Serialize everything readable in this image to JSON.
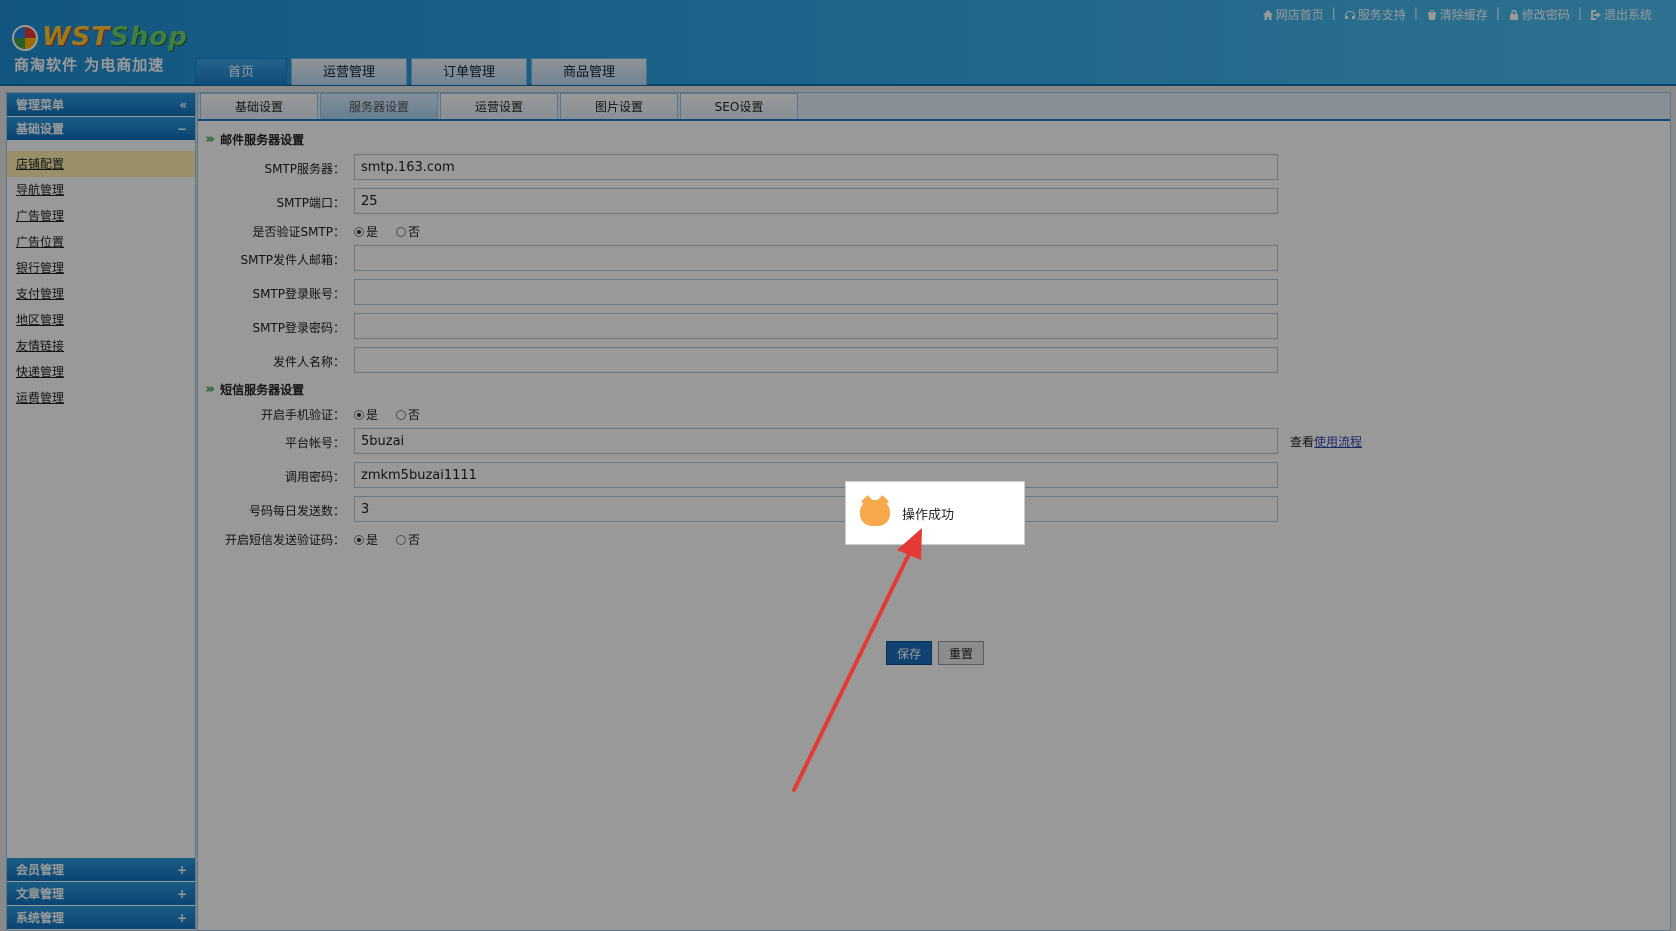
{
  "logo": {
    "name_a": "WST",
    "name_b": "Shop",
    "slogan": "商淘软件 为电商加速"
  },
  "top_links": [
    {
      "icon": "home-icon",
      "label": "网店首页"
    },
    {
      "icon": "support-icon",
      "label": "服务支持"
    },
    {
      "icon": "trash-icon",
      "label": "清除缓存"
    },
    {
      "icon": "lock-icon",
      "label": "修改密码"
    },
    {
      "icon": "logout-icon",
      "label": "退出系统"
    }
  ],
  "link_separator": "|",
  "main_nav": [
    "首页",
    "运营管理",
    "订单管理",
    "商品管理"
  ],
  "sidebar": {
    "header": "管理菜单",
    "collapse_symbol": "«",
    "group": "基础设置",
    "group_toggle": "−",
    "items": [
      "店铺配置",
      "导航管理",
      "广告管理",
      "广告位置",
      "银行管理",
      "支付管理",
      "地区管理",
      "友情链接",
      "快递管理",
      "运费管理"
    ],
    "bottom_groups": [
      "会员管理",
      "文章管理",
      "系统管理"
    ],
    "expand_symbol": "+"
  },
  "sub_tabs": [
    "基础设置",
    "服务器设置",
    "运营设置",
    "图片设置",
    "SEO设置"
  ],
  "mail": {
    "title": "邮件服务器设置",
    "smtp_server_label": "SMTP服务器：",
    "smtp_server": "smtp.163.com",
    "smtp_port_label": "SMTP端口：",
    "smtp_port": "25",
    "smtp_auth_label": "是否验证SMTP：",
    "sender_email_label": "SMTP发件人邮箱：",
    "sender_email": "",
    "login_account_label": "SMTP登录账号：",
    "login_account": "",
    "login_password_label": "SMTP登录密码：",
    "login_password": "",
    "sender_name_label": "发件人名称：",
    "sender_name": ""
  },
  "sms": {
    "title": "短信服务器设置",
    "phone_verify_label": "开启手机验证：",
    "platform_account_label": "平台帐号：",
    "platform_account": "5buzai",
    "help_prefix": "查看",
    "help_link": "使用流程",
    "api_password_label": "调用密码：",
    "api_password": "zmkm5buzai1111",
    "daily_limit_label": "号码每日发送数：",
    "daily_limit": "3",
    "sms_code_label": "开启短信发送验证码："
  },
  "radio": {
    "yes": "是",
    "no": "否"
  },
  "buttons": {
    "save": "保存",
    "reset": "重置"
  },
  "toast": {
    "text": "操作成功"
  },
  "colors": {
    "header_blue": "#1e90d5",
    "active_tab": "#1a7fcc",
    "arrow": "#e53935",
    "toast_icon": "#f5a94a"
  }
}
